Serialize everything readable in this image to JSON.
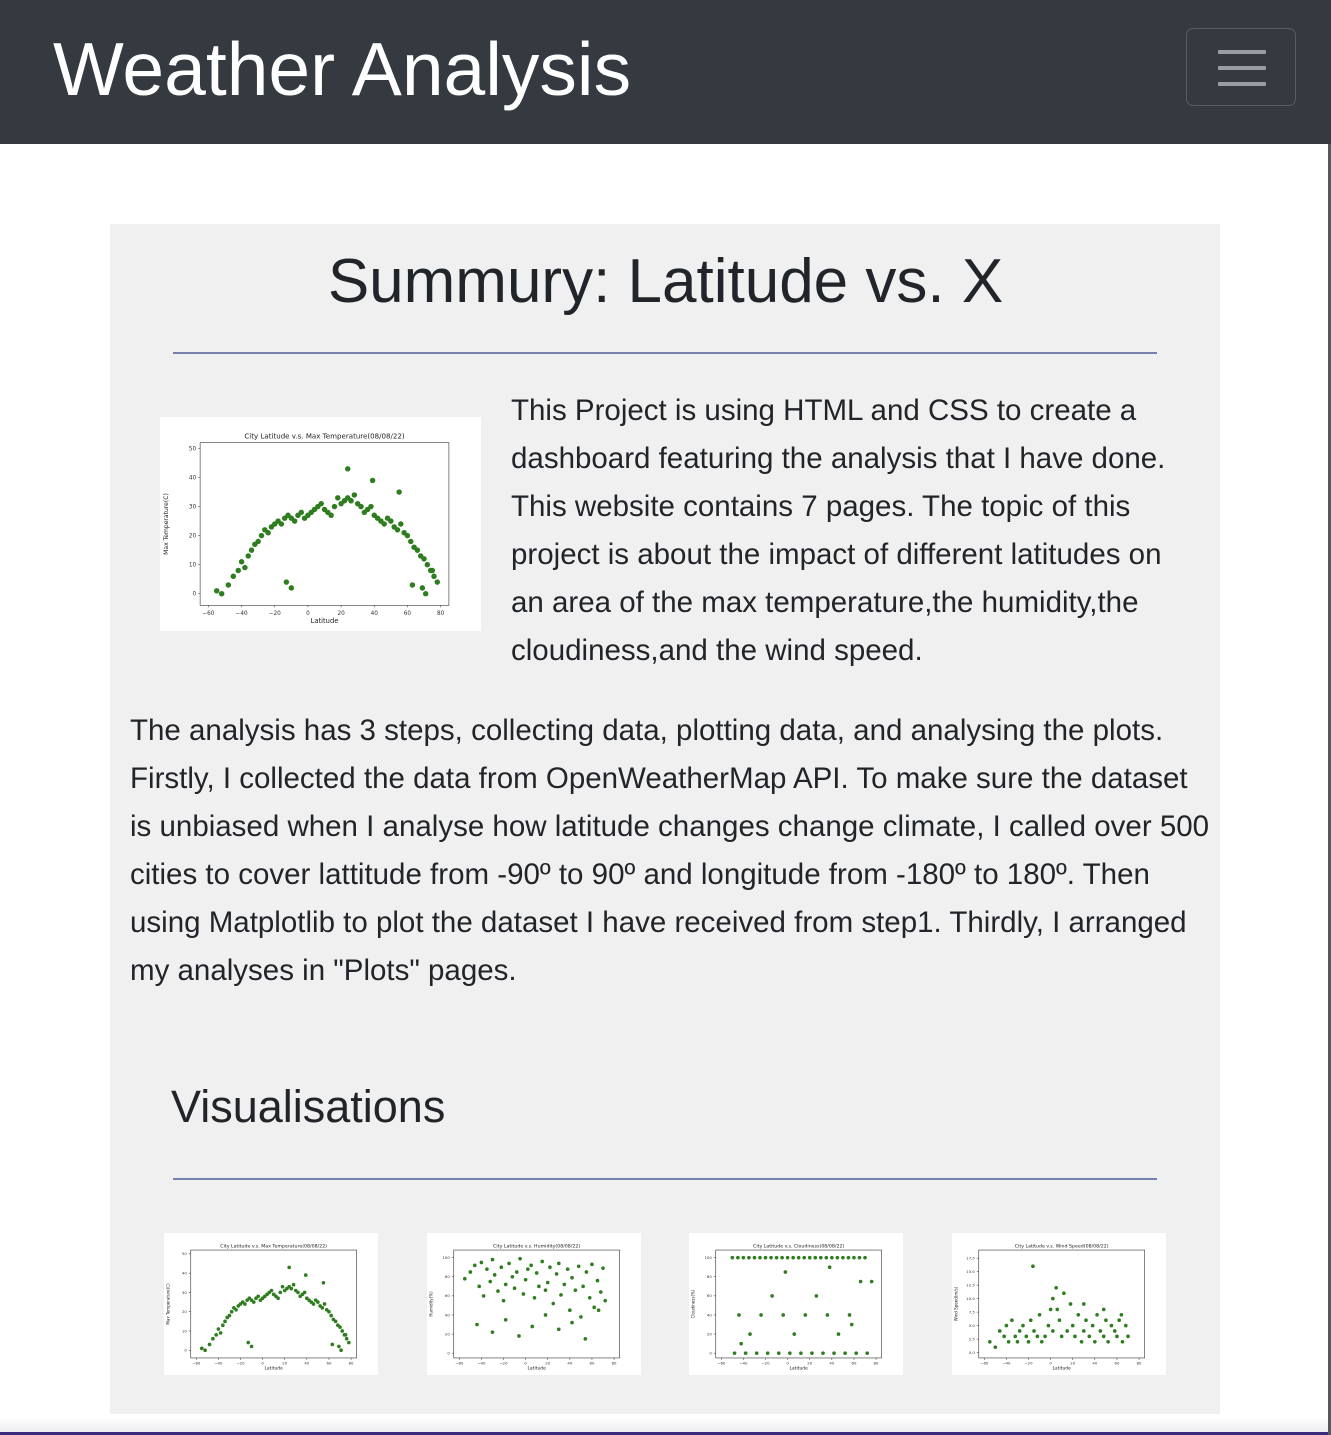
{
  "navbar": {
    "brand": "Weather Analysis",
    "toggler_icon": "hamburger-menu-icon"
  },
  "summary": {
    "title": "Summury: Latitude vs. X",
    "intro": "This Project is using HTML and CSS to create a dashboard featuring the analysis that I have done. This website contains 7 pages. The topic of this project is about the impact of different latitudes on an area of the max temperature,the humidity,the cloudiness,and the wind speed.",
    "steps": "The analysis has 3 steps, collecting data, plotting data, and analysing the plots. Firstly, I collected the data from OpenWeatherMap API. To make sure the dataset is unbiased when I analyse how latitude changes change climate, I called over 500 cities to cover lattitude from -90º to 90º and longitude from -180º to 180º. Then using Matplotlib to plot the dataset I have received from step1. Thirdly, I arranged my analyses in \"Plots\" pages."
  },
  "visualisations": {
    "title": "Visualisations"
  },
  "chart_data": [
    {
      "type": "scatter",
      "id": "temp",
      "title": "City Latitude v.s. Max Temperature(08/08/22)",
      "xlabel": "Latitude",
      "ylabel": "Max Temperature(C)",
      "xlim": [
        -65,
        85
      ],
      "ylim": [
        -4,
        52
      ],
      "xticks": [
        -60,
        -40,
        -20,
        0,
        20,
        40,
        60,
        80
      ],
      "yticks": [
        0,
        10,
        20,
        30,
        40,
        50
      ],
      "color": "#2e7d1f",
      "x": [
        -55,
        -52,
        -48,
        -45,
        -42,
        -40,
        -38,
        -36,
        -34,
        -32,
        -30,
        -28,
        -26,
        -24,
        -22,
        -20,
        -18,
        -16,
        -14,
        -12,
        -10,
        -8,
        -6,
        -4,
        -2,
        0,
        2,
        4,
        6,
        8,
        10,
        12,
        14,
        16,
        18,
        20,
        22,
        24,
        26,
        28,
        30,
        32,
        34,
        36,
        38,
        40,
        42,
        44,
        46,
        48,
        50,
        52,
        54,
        56,
        58,
        60,
        62,
        64,
        66,
        68,
        70,
        72,
        74,
        76,
        78,
        -13,
        -10,
        24,
        39,
        55,
        63,
        69,
        71,
        75
      ],
      "y": [
        1,
        0,
        3,
        6,
        8,
        11,
        9,
        13,
        15,
        17,
        18,
        20,
        22,
        21,
        23,
        24,
        25,
        24,
        26,
        27,
        26,
        25,
        27,
        28,
        26,
        27,
        28,
        29,
        30,
        31,
        29,
        28,
        27,
        30,
        33,
        31,
        32,
        33,
        32,
        34,
        31,
        30,
        28,
        29,
        30,
        27,
        26,
        25,
        24,
        26,
        25,
        23,
        22,
        24,
        21,
        20,
        18,
        16,
        15,
        13,
        12,
        10,
        8,
        6,
        4,
        4,
        2,
        43,
        39,
        35,
        3,
        2,
        0,
        8
      ]
    },
    {
      "type": "scatter",
      "id": "humidity",
      "title": "City Latitude v.s. Humidity(08/08/22)",
      "xlabel": "Latitude",
      "ylabel": "Humidity(%)",
      "xlim": [
        -65,
        85
      ],
      "ylim": [
        -5,
        108
      ],
      "xticks": [
        -60,
        -40,
        -20,
        0,
        20,
        40,
        60,
        80
      ],
      "yticks": [
        0,
        20,
        40,
        60,
        80,
        100
      ],
      "color": "#2e7d1f",
      "x": [
        -55,
        -50,
        -46,
        -42,
        -40,
        -38,
        -35,
        -32,
        -30,
        -28,
        -25,
        -22,
        -20,
        -18,
        -15,
        -12,
        -10,
        -8,
        -5,
        -2,
        0,
        2,
        5,
        8,
        10,
        12,
        15,
        18,
        20,
        22,
        25,
        28,
        30,
        32,
        35,
        38,
        40,
        42,
        45,
        48,
        50,
        52,
        55,
        58,
        60,
        62,
        65,
        68,
        70,
        72,
        -44,
        -30,
        -18,
        -6,
        6,
        18,
        30,
        42,
        54,
        66
      ],
      "y": [
        78,
        85,
        92,
        70,
        95,
        60,
        88,
        75,
        98,
        82,
        65,
        90,
        55,
        72,
        94,
        80,
        68,
        85,
        99,
        62,
        77,
        88,
        92,
        58,
        84,
        70,
        96,
        66,
        74,
        90,
        52,
        83,
        94,
        61,
        72,
        88,
        45,
        79,
        66,
        91,
        38,
        70,
        85,
        58,
        93,
        48,
        76,
        64,
        89,
        55,
        30,
        22,
        35,
        18,
        28,
        40,
        25,
        32,
        15,
        45
      ]
    },
    {
      "type": "scatter",
      "id": "cloud",
      "title": "City Latitude v.s. Cloudiness(08/08/22)",
      "xlabel": "Latitude",
      "ylabel": "Cloudiness(%)",
      "xlim": [
        -65,
        85
      ],
      "ylim": [
        -5,
        108
      ],
      "xticks": [
        -60,
        -40,
        -20,
        0,
        20,
        40,
        60,
        80
      ],
      "yticks": [
        0,
        20,
        40,
        60,
        80,
        100
      ],
      "color": "#2e7d1f",
      "x": [
        -50,
        -45,
        -40,
        -35,
        -30,
        -25,
        -20,
        -15,
        -10,
        -5,
        0,
        5,
        10,
        15,
        20,
        25,
        30,
        35,
        40,
        45,
        50,
        55,
        60,
        65,
        70,
        -48,
        -38,
        -28,
        -18,
        -8,
        2,
        12,
        22,
        32,
        42,
        52,
        62,
        72,
        -44,
        -24,
        -4,
        16,
        36,
        56,
        76,
        -34,
        -14,
        6,
        26,
        46,
        66,
        -42,
        -2,
        38,
        58
      ],
      "y": [
        100,
        100,
        100,
        100,
        100,
        100,
        100,
        100,
        100,
        100,
        100,
        100,
        100,
        100,
        100,
        100,
        100,
        100,
        100,
        100,
        100,
        100,
        100,
        100,
        100,
        0,
        0,
        0,
        0,
        0,
        0,
        0,
        0,
        0,
        0,
        0,
        0,
        0,
        40,
        40,
        40,
        40,
        40,
        40,
        75,
        20,
        60,
        20,
        60,
        20,
        75,
        10,
        85,
        90,
        30
      ]
    },
    {
      "type": "scatter",
      "id": "wind",
      "title": "City Latitude v.s. Wind Speed(08/08/22)",
      "xlabel": "Latitude",
      "ylabel": "Wind Speed(m/s)",
      "xlim": [
        -65,
        85
      ],
      "ylim": [
        -1,
        19
      ],
      "xticks": [
        -60,
        -40,
        -20,
        0,
        20,
        40,
        60,
        80
      ],
      "yticks": [
        0.0,
        2.5,
        5.0,
        7.5,
        10.0,
        12.5,
        15.0,
        17.5
      ],
      "color": "#2e7d1f",
      "x": [
        -55,
        -50,
        -46,
        -42,
        -40,
        -38,
        -35,
        -32,
        -30,
        -28,
        -25,
        -22,
        -20,
        -18,
        -15,
        -12,
        -10,
        -8,
        -5,
        -2,
        0,
        2,
        5,
        8,
        10,
        12,
        15,
        18,
        20,
        22,
        25,
        28,
        30,
        32,
        35,
        38,
        40,
        42,
        45,
        48,
        50,
        52,
        55,
        58,
        60,
        62,
        65,
        68,
        70,
        -16,
        2,
        6,
        30,
        48,
        64
      ],
      "y": [
        2,
        1,
        4,
        3,
        5,
        2,
        6,
        3,
        2,
        4,
        5,
        3,
        2,
        6,
        4,
        3,
        7,
        2,
        3,
        5,
        8,
        4,
        12,
        6,
        3,
        11,
        4,
        9,
        5,
        3,
        7,
        2,
        4,
        6,
        3,
        5,
        2,
        7,
        4,
        3,
        6,
        2,
        5,
        4,
        3,
        6,
        2,
        5,
        3,
        16,
        10,
        8,
        9,
        8,
        7
      ]
    }
  ]
}
